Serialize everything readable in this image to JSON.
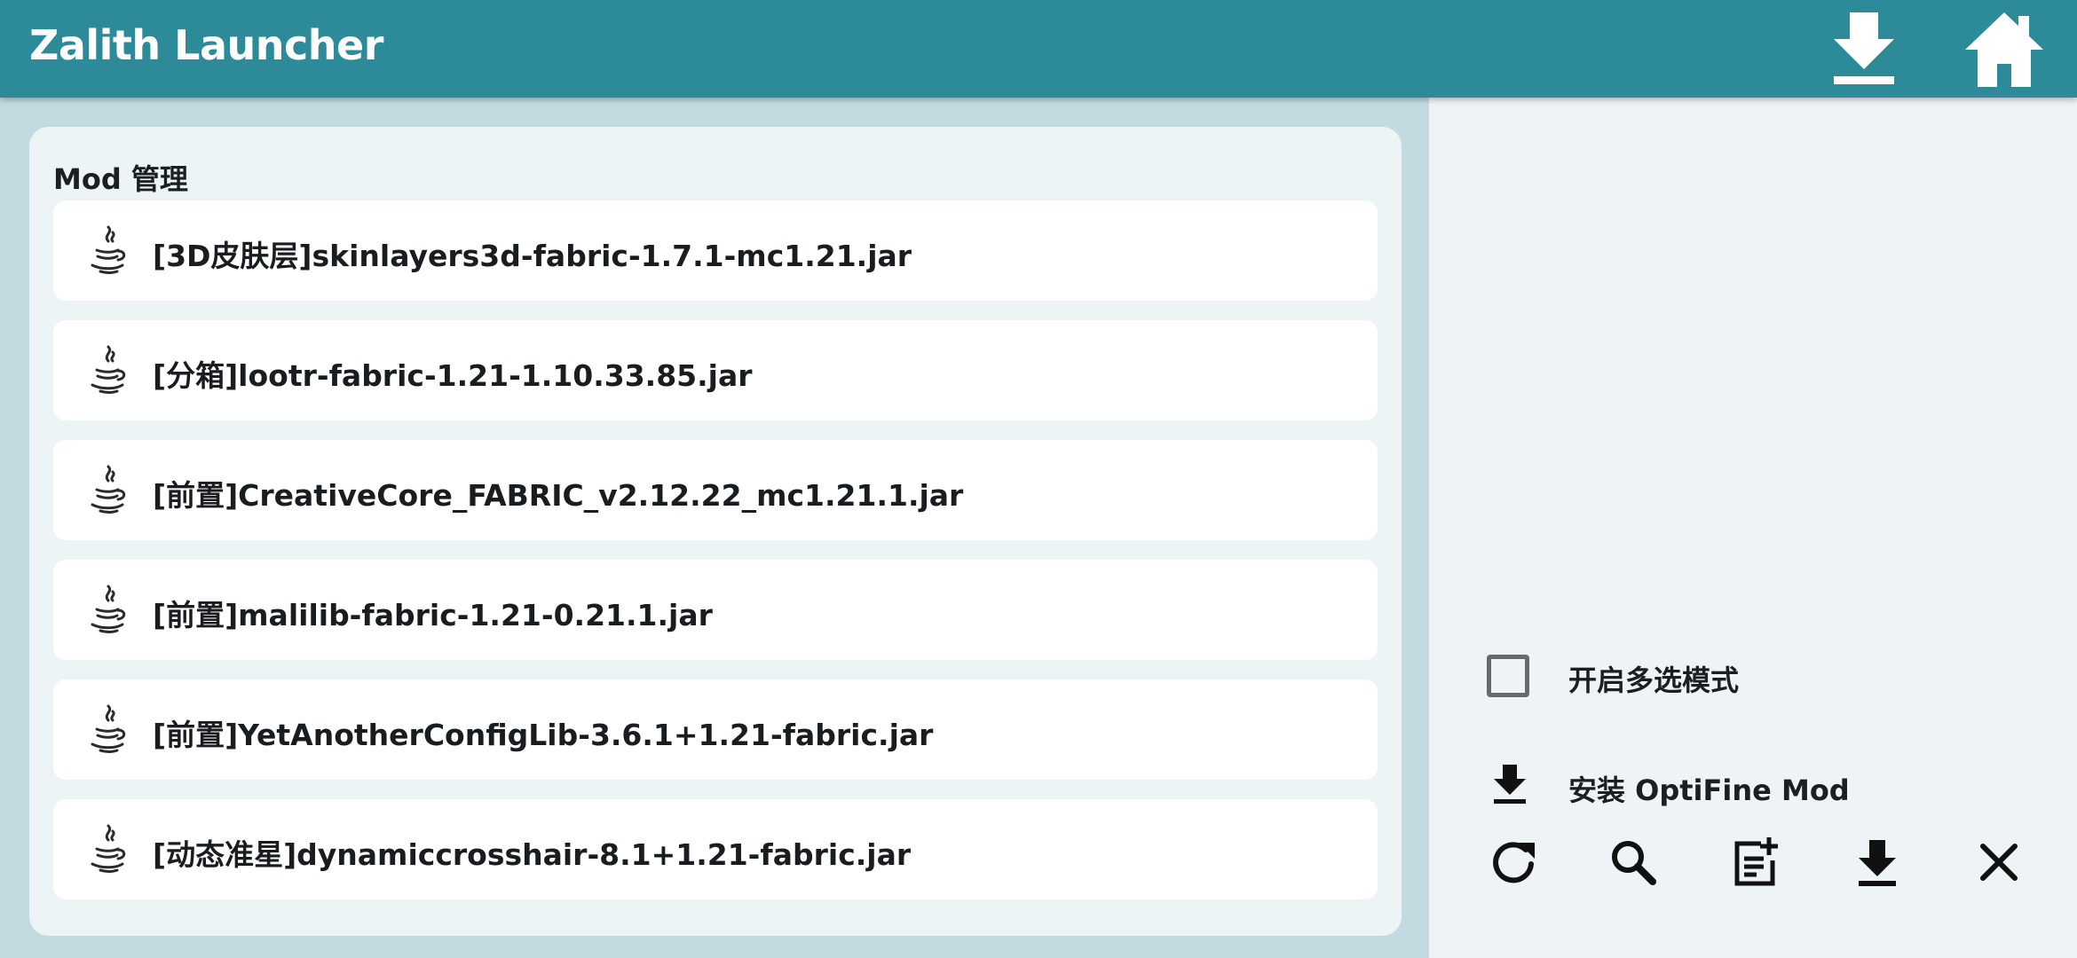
{
  "app": {
    "title": "Zalith Launcher"
  },
  "topbar": {
    "icons": [
      "download-icon",
      "home-icon"
    ]
  },
  "mods": {
    "title": "Mod 管理",
    "items": [
      {
        "name": "[3D皮肤层]skinlayers3d-fabric-1.7.1-mc1.21.jar",
        "icon": "java-icon"
      },
      {
        "name": "[分箱]lootr-fabric-1.21-1.10.33.85.jar",
        "icon": "java-icon"
      },
      {
        "name": "[前置]CreativeCore_FABRIC_v2.12.22_mc1.21.1.jar",
        "icon": "java-icon"
      },
      {
        "name": "[前置]malilib-fabric-1.21-0.21.1.jar",
        "icon": "java-icon"
      },
      {
        "name": "[前置]YetAnotherConfigLib-3.6.1+1.21-fabric.jar",
        "icon": "java-icon"
      },
      {
        "name": "[动态准星]dynamiccrosshair-8.1+1.21-fabric.jar",
        "icon": "java-icon"
      }
    ]
  },
  "side": {
    "multi_select_label": "开启多选模式",
    "multi_select_checked": false,
    "install_optifine_label": "安装 OptiFine Mod",
    "actions": [
      "refresh-icon",
      "search-icon",
      "add-file-icon",
      "download-icon",
      "close-icon"
    ]
  },
  "colors": {
    "topbar": "#2d8b99",
    "left_background": "#c2dbe0",
    "card_background": "#edf4f6",
    "item_background": "#ffffff",
    "right_background": "#eef4f6",
    "text": "#1b1f22"
  }
}
